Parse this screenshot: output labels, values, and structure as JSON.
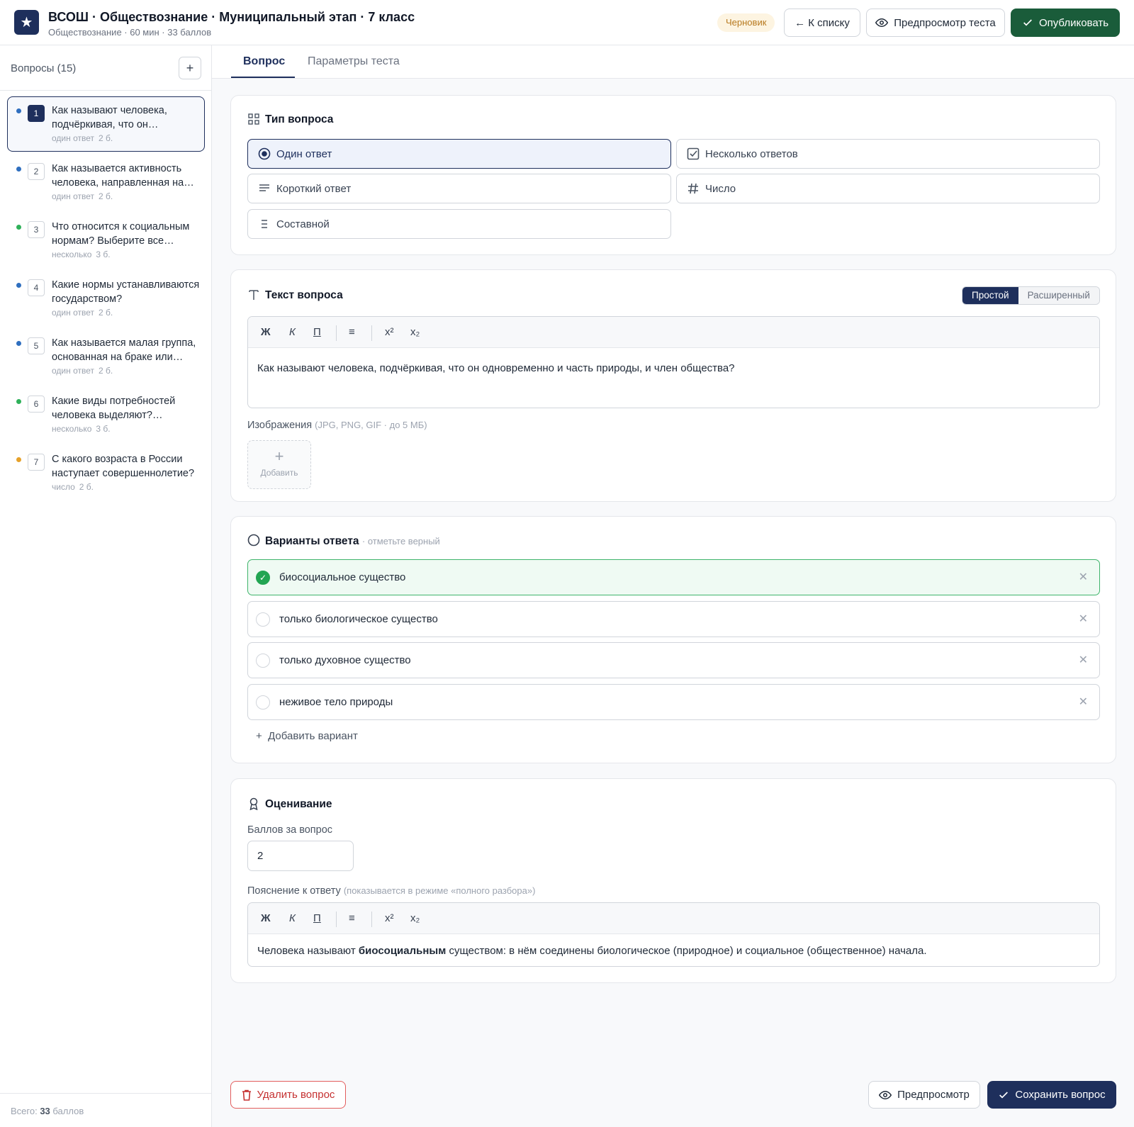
{
  "header": {
    "title": "ВСОШ · Обществознание · Муниципальный этап · 7 класс",
    "subtitle": "Обществознание · 60 мин · 33 баллов",
    "status_badge": "Черновик",
    "back_label": "← К списку",
    "preview_test_label": "Предпросмотр теста",
    "publish_label": "Опубликовать"
  },
  "sidebar": {
    "title": "Вопросы (15)",
    "add_symbol": "+",
    "items": [
      {
        "num": "1",
        "text": "Как называют человека, подчёркивая, что он одновременно и часть природы, и член общества?",
        "type": "один ответ",
        "points": "2 б.",
        "dot": "#2f6fbf"
      },
      {
        "num": "2",
        "text": "Как называется активность человека, направленная на изменение окружающего мира?",
        "type": "один ответ",
        "points": "2 б.",
        "dot": "#2f6fbf"
      },
      {
        "num": "3",
        "text": "Что относится к социальным нормам? Выберите все верные варианты.",
        "type": "несколько",
        "points": "3 б.",
        "dot": "#2fb15a"
      },
      {
        "num": "4",
        "text": "Какие нормы устанавливаются государством?",
        "type": "один ответ",
        "points": "2 б.",
        "dot": "#2f6fbf"
      },
      {
        "num": "5",
        "text": "Как называется малая группа, основанная на браке или кровном родстве?",
        "type": "один ответ",
        "points": "2 б.",
        "dot": "#2f6fbf"
      },
      {
        "num": "6",
        "text": "Какие виды потребностей человека выделяют? Выберите все верные.",
        "type": "несколько",
        "points": "3 б.",
        "dot": "#2fb15a"
      },
      {
        "num": "7",
        "text": "С какого возраста в России наступает совершеннолетие?",
        "type": "число",
        "points": "2 б.",
        "dot": "#e6a12a"
      }
    ],
    "footer_prefix": "Всего: ",
    "footer_total": "33",
    "footer_suffix": " баллов"
  },
  "tabs": {
    "question": "Вопрос",
    "params": "Параметры теста"
  },
  "question_type": {
    "title": "Тип вопроса",
    "single": "Один ответ",
    "multiple": "Несколько ответов",
    "short": "Короткий ответ",
    "number": "Число",
    "compound": "Составной",
    "selected": "Один ответ"
  },
  "question_text": {
    "title": "Текст вопроса",
    "mode_simple": "Простой",
    "mode_advanced": "Расширенный",
    "toolbar": {
      "bold": "Ж",
      "italic": "К",
      "underline": "П",
      "list": "≡",
      "sup": "x²",
      "sub": "x₂"
    },
    "content": "Как называют человека, подчёркивая, что он одновременно и часть природы, и член общества?",
    "images_label": "Изображения",
    "images_hint": "(JPG, PNG, GIF · до 5 МБ)",
    "add_image_label": "Добавить"
  },
  "answers": {
    "title": "Варианты ответа",
    "hint": "· отметьте верный",
    "options": [
      {
        "text": "биосоциальное существо",
        "correct": true
      },
      {
        "text": "только биологическое существо",
        "correct": false
      },
      {
        "text": "только духовное существо",
        "correct": false
      },
      {
        "text": "неживое тело природы",
        "correct": false
      }
    ],
    "add_option": "Добавить вариант"
  },
  "grading": {
    "title": "Оценивание",
    "points_label": "Баллов за вопрос",
    "points_value": "2",
    "explanation_label": "Пояснение к ответу",
    "explanation_hint": "(показывается в режиме «полного разбора»)",
    "explanation_before": "Человека называют ",
    "explanation_bold": "биосоциальным",
    "explanation_after": " существом: в нём соединены биологическое (природное) и социальное (общественное) начала."
  },
  "footer": {
    "delete_label": "Удалить вопрос",
    "preview_label": "Предпросмотр",
    "save_label": "Сохранить вопрос"
  },
  "colors": {
    "primary": "#1e2f5c",
    "publish": "#1a5c3a",
    "correct": "#22a552",
    "danger": "#c53030"
  }
}
